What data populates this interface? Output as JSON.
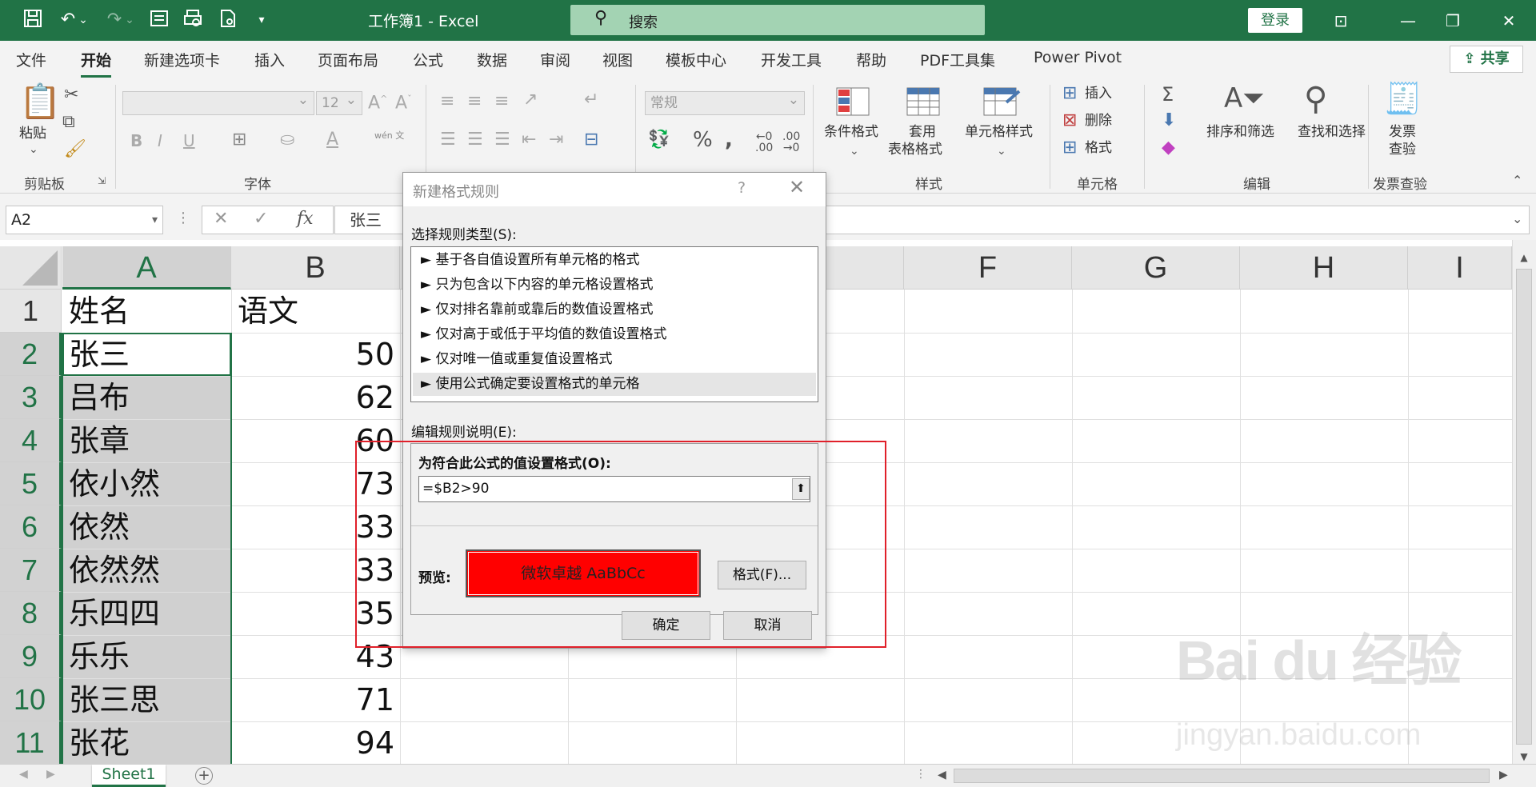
{
  "titlebar": {
    "doc_title": "工作簿1  -  Excel",
    "search_placeholder": "搜索",
    "login_label": "登录",
    "icons": [
      "save-icon",
      "undo-icon",
      "redo-icon",
      "form-icon",
      "print-preview-icon",
      "doc-icon",
      "customize-icon"
    ]
  },
  "tabs": [
    "文件",
    "开始",
    "新建选项卡",
    "插入",
    "页面布局",
    "公式",
    "数据",
    "审阅",
    "视图",
    "模板中心",
    "开发工具",
    "帮助",
    "PDF工具集",
    "Power Pivot"
  ],
  "active_tab": "开始",
  "share_label": "共享",
  "ribbon": {
    "clipboard": {
      "label": "剪贴板",
      "paste": "粘贴"
    },
    "font": {
      "label": "字体",
      "size": "12",
      "phonetic": "wén 文"
    },
    "alignment": {},
    "number": {
      "format": "常规"
    },
    "styles": {
      "label": "样式",
      "conditional": "条件格式",
      "table_fmt_1": "套用",
      "table_fmt_2": "表格格式",
      "cell_styles": "单元格样式"
    },
    "cells": {
      "label": "单元格",
      "insert": "插入",
      "delete": "删除",
      "format": "格式"
    },
    "editing": {
      "label": "编辑",
      "sort": "排序和筛选",
      "find": "查找和选择"
    },
    "invoice": {
      "label": "发票查验",
      "btn_1": "发票",
      "btn_2": "查验"
    }
  },
  "formula_bar": {
    "name_box": "A2",
    "fx": "fx",
    "value": "张三"
  },
  "sheet": {
    "columns": [
      "A",
      "B",
      "",
      "",
      "",
      "F",
      "G",
      "H",
      "I"
    ],
    "rows": [
      "1",
      "2",
      "3",
      "4",
      "5",
      "6",
      "7",
      "8",
      "9",
      "10",
      "11"
    ],
    "header_row": {
      "a": "姓名",
      "b": "语文"
    },
    "data": [
      {
        "a": "张三",
        "b": "50"
      },
      {
        "a": "吕布",
        "b": "62"
      },
      {
        "a": "张章",
        "b": "60"
      },
      {
        "a": "依小然",
        "b": "73"
      },
      {
        "a": "依然",
        "b": "33"
      },
      {
        "a": "依然然",
        "b": "33"
      },
      {
        "a": "乐四四",
        "b": "35"
      },
      {
        "a": "乐乐",
        "b": "43"
      },
      {
        "a": "张三思",
        "b": "71"
      },
      {
        "a": "张花",
        "b": "94"
      }
    ],
    "tab_name": "Sheet1"
  },
  "dialog": {
    "title": "新建格式规则",
    "help": "?",
    "select_type_label": "选择规则类型(S):",
    "rule_types": [
      "► 基于各自值设置所有单元格的格式",
      "► 只为包含以下内容的单元格设置格式",
      "► 仅对排名靠前或靠后的数值设置格式",
      "► 仅对高于或低于平均值的数值设置格式",
      "► 仅对唯一值或重复值设置格式",
      "► 使用公式确定要设置格式的单元格"
    ],
    "selected_rule_index": 5,
    "edit_desc_label": "编辑规则说明(E):",
    "formula_label": "为符合此公式的值设置格式(O):",
    "formula_value": "=$B2>90",
    "preview_label": "预览:",
    "preview_text": "微软卓越  AaBbCc",
    "preview_fill": "#ff0000",
    "format_btn": "格式(F)...",
    "ok_btn": "确定",
    "cancel_btn": "取消"
  },
  "watermark": {
    "logo": "Bai du 经验",
    "url": "jingyan.baidu.com"
  },
  "colors": {
    "excel_green": "#217346",
    "annotation_red": "#e0202a"
  }
}
